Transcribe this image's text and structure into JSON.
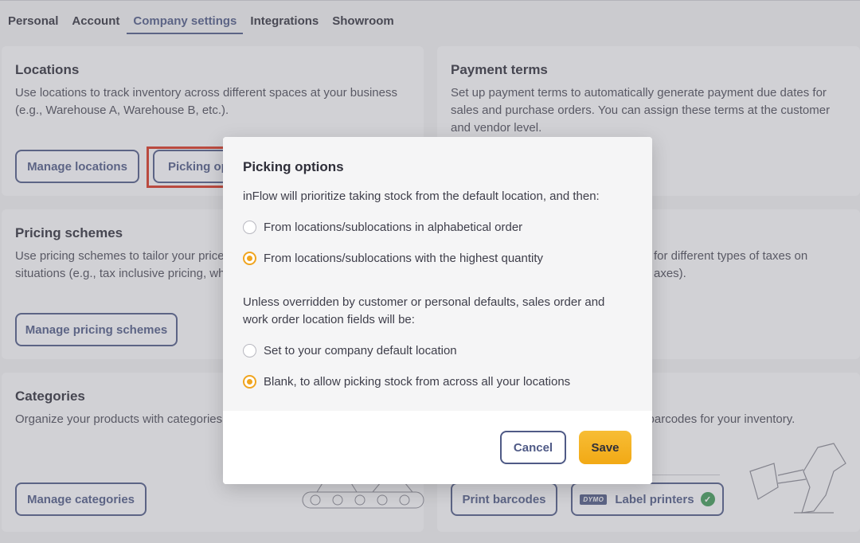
{
  "tabs": [
    "Personal",
    "Account",
    "Company settings",
    "Integrations",
    "Showroom"
  ],
  "locations": {
    "title": "Locations",
    "desc": "Use locations to track inventory across different spaces at your business (e.g., Warehouse A, Warehouse B, etc.).",
    "manage_label": "Manage locations",
    "picking_label": "Picking op"
  },
  "payment": {
    "title": "Payment terms",
    "desc": "Set up payment terms to automatically generate payment due dates for sales and purchase orders. You can assign these terms at the customer and vendor level."
  },
  "pricing": {
    "title": "Pricing schemes",
    "desc": "Use pricing schemes to tailor your prices situations (e.g., tax inclusive pricing, wh",
    "manage_label": "Manage pricing schemes"
  },
  "taxes": {
    "desc": "for different types of taxes on axes)."
  },
  "categories": {
    "title": "Categories",
    "desc": "Organize your products with categories.",
    "manage_label": "Manage categories"
  },
  "barcodes": {
    "desc": "p barcodes for your inventory.",
    "print_label": "Print barcodes",
    "printers_label": "Label printers",
    "dymo_label": "DYMO"
  },
  "modal": {
    "title": "Picking options",
    "intro": "inFlow will prioritize taking stock from the default location, and then:",
    "option1": "From locations/sublocations in alphabetical order",
    "option2": "From locations/sublocations with the highest quantity",
    "intro2": "Unless overridden by customer or personal defaults, sales order and work order location fields will be:",
    "option3": "Set to your company default location",
    "option4": "Blank, to allow picking stock from across all your locations",
    "cancel_label": "Cancel",
    "save_label": "Save"
  },
  "colors": {
    "accent": "#4f5a86",
    "save": "#f6b524",
    "radio_selected": "#f0a520",
    "highlight": "#d9341f"
  }
}
